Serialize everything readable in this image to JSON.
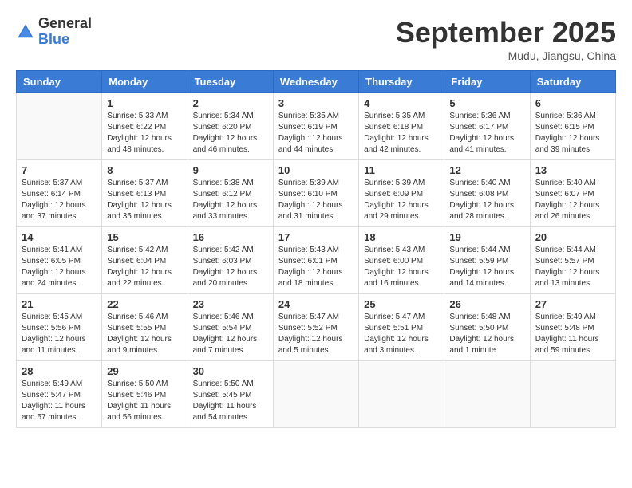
{
  "header": {
    "logo_general": "General",
    "logo_blue": "Blue",
    "month_title": "September 2025",
    "location": "Mudu, Jiangsu, China"
  },
  "weekdays": [
    "Sunday",
    "Monday",
    "Tuesday",
    "Wednesday",
    "Thursday",
    "Friday",
    "Saturday"
  ],
  "weeks": [
    [
      {
        "day": "",
        "info": ""
      },
      {
        "day": "1",
        "info": "Sunrise: 5:33 AM\nSunset: 6:22 PM\nDaylight: 12 hours\nand 48 minutes."
      },
      {
        "day": "2",
        "info": "Sunrise: 5:34 AM\nSunset: 6:20 PM\nDaylight: 12 hours\nand 46 minutes."
      },
      {
        "day": "3",
        "info": "Sunrise: 5:35 AM\nSunset: 6:19 PM\nDaylight: 12 hours\nand 44 minutes."
      },
      {
        "day": "4",
        "info": "Sunrise: 5:35 AM\nSunset: 6:18 PM\nDaylight: 12 hours\nand 42 minutes."
      },
      {
        "day": "5",
        "info": "Sunrise: 5:36 AM\nSunset: 6:17 PM\nDaylight: 12 hours\nand 41 minutes."
      },
      {
        "day": "6",
        "info": "Sunrise: 5:36 AM\nSunset: 6:15 PM\nDaylight: 12 hours\nand 39 minutes."
      }
    ],
    [
      {
        "day": "7",
        "info": "Sunrise: 5:37 AM\nSunset: 6:14 PM\nDaylight: 12 hours\nand 37 minutes."
      },
      {
        "day": "8",
        "info": "Sunrise: 5:37 AM\nSunset: 6:13 PM\nDaylight: 12 hours\nand 35 minutes."
      },
      {
        "day": "9",
        "info": "Sunrise: 5:38 AM\nSunset: 6:12 PM\nDaylight: 12 hours\nand 33 minutes."
      },
      {
        "day": "10",
        "info": "Sunrise: 5:39 AM\nSunset: 6:10 PM\nDaylight: 12 hours\nand 31 minutes."
      },
      {
        "day": "11",
        "info": "Sunrise: 5:39 AM\nSunset: 6:09 PM\nDaylight: 12 hours\nand 29 minutes."
      },
      {
        "day": "12",
        "info": "Sunrise: 5:40 AM\nSunset: 6:08 PM\nDaylight: 12 hours\nand 28 minutes."
      },
      {
        "day": "13",
        "info": "Sunrise: 5:40 AM\nSunset: 6:07 PM\nDaylight: 12 hours\nand 26 minutes."
      }
    ],
    [
      {
        "day": "14",
        "info": "Sunrise: 5:41 AM\nSunset: 6:05 PM\nDaylight: 12 hours\nand 24 minutes."
      },
      {
        "day": "15",
        "info": "Sunrise: 5:42 AM\nSunset: 6:04 PM\nDaylight: 12 hours\nand 22 minutes."
      },
      {
        "day": "16",
        "info": "Sunrise: 5:42 AM\nSunset: 6:03 PM\nDaylight: 12 hours\nand 20 minutes."
      },
      {
        "day": "17",
        "info": "Sunrise: 5:43 AM\nSunset: 6:01 PM\nDaylight: 12 hours\nand 18 minutes."
      },
      {
        "day": "18",
        "info": "Sunrise: 5:43 AM\nSunset: 6:00 PM\nDaylight: 12 hours\nand 16 minutes."
      },
      {
        "day": "19",
        "info": "Sunrise: 5:44 AM\nSunset: 5:59 PM\nDaylight: 12 hours\nand 14 minutes."
      },
      {
        "day": "20",
        "info": "Sunrise: 5:44 AM\nSunset: 5:57 PM\nDaylight: 12 hours\nand 13 minutes."
      }
    ],
    [
      {
        "day": "21",
        "info": "Sunrise: 5:45 AM\nSunset: 5:56 PM\nDaylight: 12 hours\nand 11 minutes."
      },
      {
        "day": "22",
        "info": "Sunrise: 5:46 AM\nSunset: 5:55 PM\nDaylight: 12 hours\nand 9 minutes."
      },
      {
        "day": "23",
        "info": "Sunrise: 5:46 AM\nSunset: 5:54 PM\nDaylight: 12 hours\nand 7 minutes."
      },
      {
        "day": "24",
        "info": "Sunrise: 5:47 AM\nSunset: 5:52 PM\nDaylight: 12 hours\nand 5 minutes."
      },
      {
        "day": "25",
        "info": "Sunrise: 5:47 AM\nSunset: 5:51 PM\nDaylight: 12 hours\nand 3 minutes."
      },
      {
        "day": "26",
        "info": "Sunrise: 5:48 AM\nSunset: 5:50 PM\nDaylight: 12 hours\nand 1 minute."
      },
      {
        "day": "27",
        "info": "Sunrise: 5:49 AM\nSunset: 5:48 PM\nDaylight: 11 hours\nand 59 minutes."
      }
    ],
    [
      {
        "day": "28",
        "info": "Sunrise: 5:49 AM\nSunset: 5:47 PM\nDaylight: 11 hours\nand 57 minutes."
      },
      {
        "day": "29",
        "info": "Sunrise: 5:50 AM\nSunset: 5:46 PM\nDaylight: 11 hours\nand 56 minutes."
      },
      {
        "day": "30",
        "info": "Sunrise: 5:50 AM\nSunset: 5:45 PM\nDaylight: 11 hours\nand 54 minutes."
      },
      {
        "day": "",
        "info": ""
      },
      {
        "day": "",
        "info": ""
      },
      {
        "day": "",
        "info": ""
      },
      {
        "day": "",
        "info": ""
      }
    ]
  ]
}
